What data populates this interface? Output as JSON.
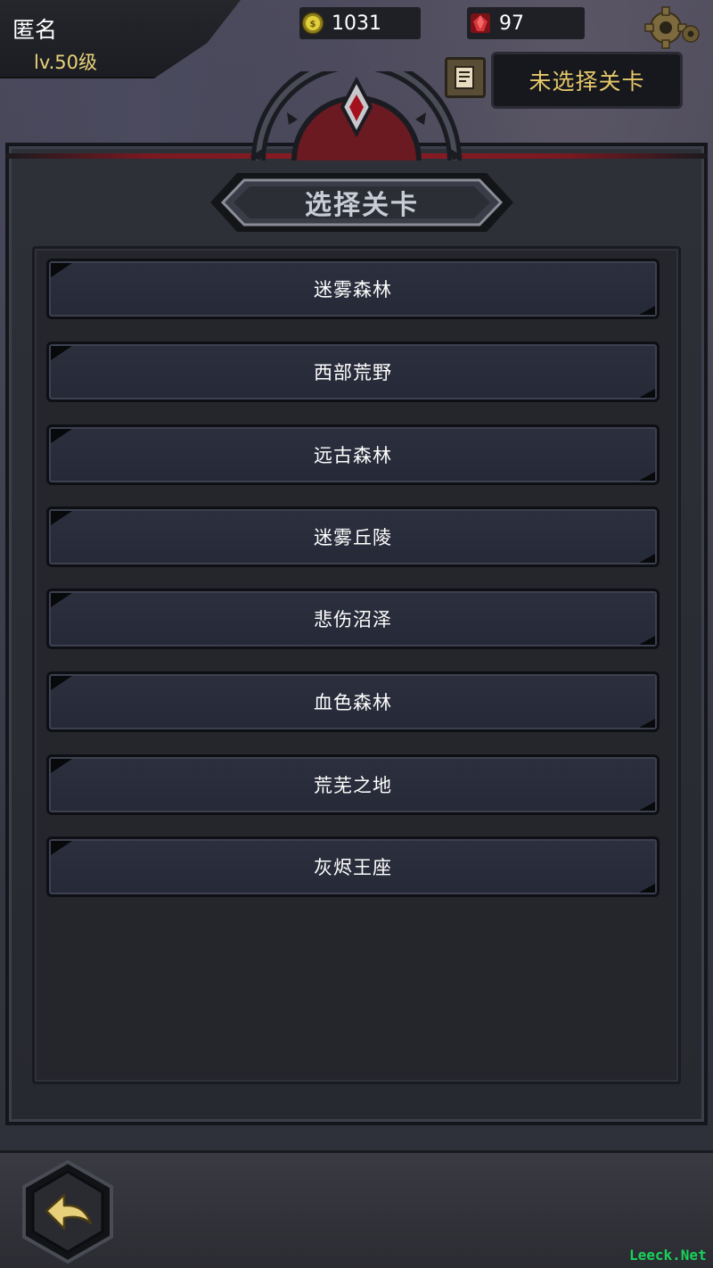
{
  "player": {
    "name": "匿名",
    "level": "lv.50级"
  },
  "resources": {
    "gold": "1031",
    "gems": "97"
  },
  "header": {
    "selected_stage_label": "未选择关卡"
  },
  "panel": {
    "title": "选择关卡"
  },
  "stages": [
    {
      "label": "迷雾森林"
    },
    {
      "label": "西部荒野"
    },
    {
      "label": "远古森林"
    },
    {
      "label": "迷雾丘陵"
    },
    {
      "label": "悲伤沼泽"
    },
    {
      "label": "血色森林"
    },
    {
      "label": "荒芜之地"
    },
    {
      "label": "灰烬王座"
    }
  ],
  "watermark": "Leeck.Net",
  "icons": {
    "gold": "gold-coin-icon",
    "gems": "red-gem-icon",
    "settings": "gear-icon",
    "quest": "scroll-icon",
    "back": "back-arrow-icon"
  },
  "colors": {
    "accent_gold": "#e6c86a",
    "level_text": "#e8d37a",
    "stage_button": "#2c2f3d",
    "panel_accent_red": "#8a1d25"
  }
}
